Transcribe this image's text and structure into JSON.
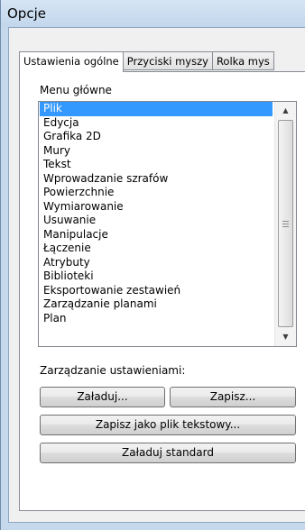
{
  "window": {
    "title": "Opcje"
  },
  "tabs": [
    {
      "label": "Ustawienia ogólne",
      "active": true
    },
    {
      "label": "Przyciski myszy",
      "active": false
    },
    {
      "label": "Rolka mys",
      "active": false
    }
  ],
  "menu": {
    "label": "Menu główne",
    "selected": "Plik",
    "items": [
      "Plik",
      "Edycja",
      "Grafika 2D",
      "Mury",
      "Tekst",
      "Wprowadzanie szrafów",
      "Powierzchnie",
      "Wymiarowanie",
      "Usuwanie",
      "Manipulacje",
      "Łączenie",
      "Atrybuty",
      "Biblioteki",
      "Eksportowanie zestawień",
      "Zarządzanie planami",
      "Plan"
    ]
  },
  "settings": {
    "label": "Zarządzanie ustawieniami:",
    "load_label": "Załaduj...",
    "save_label": "Zapisz...",
    "save_text_label": "Zapisz jako plik tekstowy...",
    "load_default_label": "Załaduj standard"
  },
  "icons": {
    "scroll_up": "scroll-up-arrow-icon",
    "scroll_down": "scroll-down-arrow-icon",
    "scroll_grip": "scroll-grip-icon"
  },
  "colors": {
    "selection": "#3399ff",
    "window_frame": "#c5d8ec"
  }
}
